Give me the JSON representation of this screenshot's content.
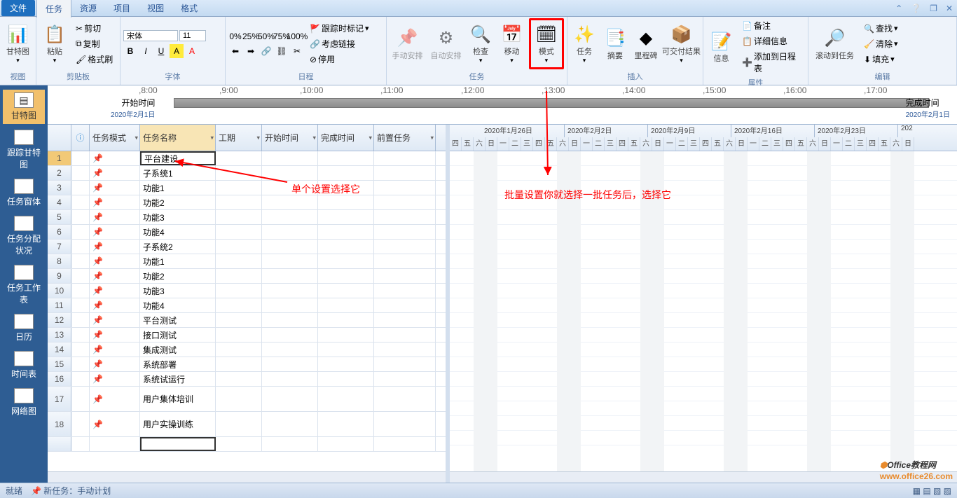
{
  "menu": {
    "file": "文件",
    "tabs": [
      "任务",
      "资源",
      "项目",
      "视图",
      "格式"
    ]
  },
  "ribbon": {
    "groups": {
      "view": {
        "label": "视图",
        "gantt": "甘特图"
      },
      "clipboard": {
        "label": "剪贴板",
        "paste": "粘贴",
        "cut": "剪切",
        "copy": "复制",
        "format_painter": "格式刷"
      },
      "font": {
        "label": "字体",
        "name": "宋体",
        "size": "11"
      },
      "schedule": {
        "label": "日程",
        "track": "跟踪时标记",
        "links": "考虑链接",
        "disable": "停用"
      },
      "tasks": {
        "label": "任务",
        "manual": "手动安排",
        "auto": "自动安排",
        "inspect": "检查",
        "move": "移动",
        "mode": "模式"
      },
      "insert": {
        "label": "插入",
        "task": "任务",
        "summary": "摘要",
        "milestone": "里程碑",
        "deliverable": "可交付结果"
      },
      "properties": {
        "label": "属性",
        "info": "信息",
        "notes": "备注",
        "details": "详细信息",
        "add_timeline": "添加到日程表"
      },
      "editing": {
        "label": "编辑",
        "scroll": "滚动到任务",
        "find": "查找",
        "clear": "清除",
        "fill": "填充"
      }
    }
  },
  "leftbar": [
    "甘特图",
    "跟踪甘特图",
    "任务窗体",
    "任务分配状况",
    "任务工作表",
    "日历",
    "时间表",
    "网络图"
  ],
  "timeline": {
    "start_label": "开始时间",
    "start_date": "2020年2月1日",
    "end_label": "完成时间",
    "end_date": "2020年2月1日",
    "ticks": [
      "8:00",
      "9:00",
      "10:00",
      "11:00",
      "12:00",
      "13:00",
      "14:00",
      "15:00",
      "16:00",
      "17:00"
    ]
  },
  "columns": {
    "mode": "任务模式",
    "name": "任务名称",
    "duration": "工期",
    "start": "开始时间",
    "finish": "完成时间",
    "pred": "前置任务"
  },
  "rows": [
    {
      "n": 1,
      "name": "平台建设"
    },
    {
      "n": 2,
      "name": "子系统1"
    },
    {
      "n": 3,
      "name": "功能1"
    },
    {
      "n": 4,
      "name": "功能2"
    },
    {
      "n": 5,
      "name": "功能3"
    },
    {
      "n": 6,
      "name": "功能4"
    },
    {
      "n": 7,
      "name": "子系统2"
    },
    {
      "n": 8,
      "name": "功能1"
    },
    {
      "n": 9,
      "name": "功能2"
    },
    {
      "n": 10,
      "name": "功能3"
    },
    {
      "n": 11,
      "name": "功能4"
    },
    {
      "n": 12,
      "name": "平台测试"
    },
    {
      "n": 13,
      "name": "接口测试"
    },
    {
      "n": 14,
      "name": "集成测试"
    },
    {
      "n": 15,
      "name": "系统部署"
    },
    {
      "n": 16,
      "name": "系统试运行"
    },
    {
      "n": 17,
      "name": "用户集体培训"
    },
    {
      "n": 18,
      "name": "用户实操训练"
    }
  ],
  "gantt_weeks": [
    "2020年1月26日",
    "2020年2月2日",
    "2020年2月9日",
    "2020年2月16日",
    "2020年2月23日",
    "202"
  ],
  "gantt_days": [
    "四",
    "五",
    "六",
    "日",
    "一",
    "二",
    "三",
    "四",
    "五",
    "六",
    "日",
    "一",
    "二",
    "三",
    "四",
    "五",
    "六",
    "日",
    "一",
    "二",
    "三",
    "四",
    "五",
    "六",
    "日",
    "一",
    "二",
    "三",
    "四",
    "五",
    "六",
    "日",
    "一",
    "二",
    "三",
    "四",
    "五",
    "六",
    "日"
  ],
  "annot": {
    "single": "单个设置选择它",
    "batch": "批量设置你就选择一批任务后，选择它"
  },
  "status": {
    "ready": "就绪",
    "mode": "新任务：手动计划"
  },
  "watermark": {
    "brand": "Office",
    "suffix": "教程网",
    "url": "www.office26.com"
  }
}
